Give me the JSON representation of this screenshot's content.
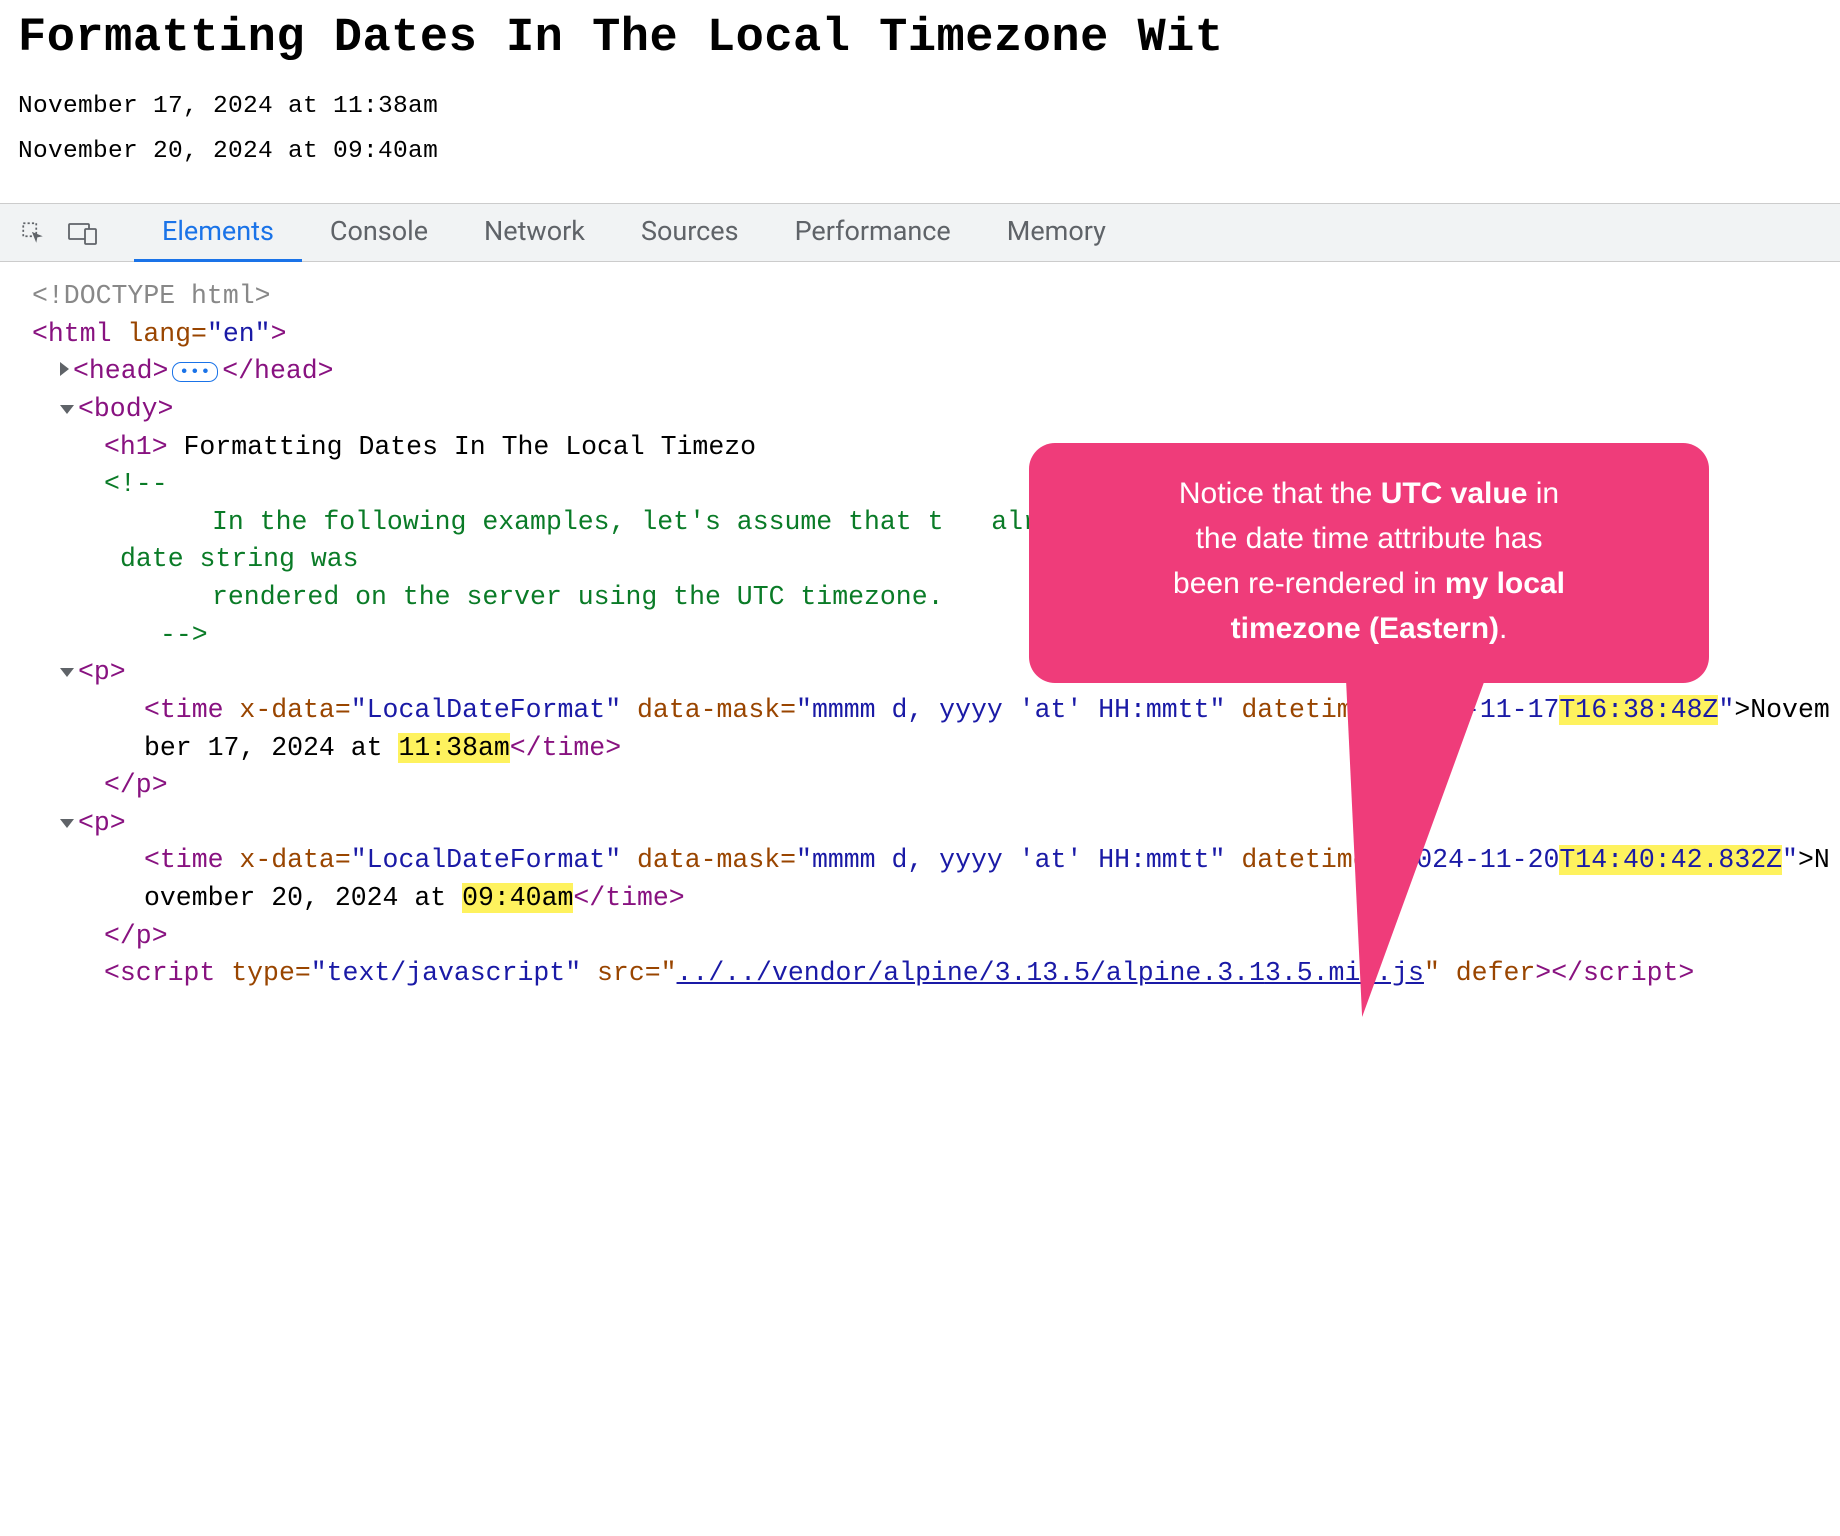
{
  "page": {
    "title": "Formatting Dates In The Local Timezone Wit",
    "date1": "November 17, 2024 at 11:38am",
    "date2": "November 20, 2024 at 09:40am"
  },
  "tabs": {
    "elements": "Elements",
    "console": "Console",
    "network": "Network",
    "sources": "Sources",
    "performance": "Performance",
    "memory": "Memory"
  },
  "dom": {
    "doctype": "<!DOCTYPE html>",
    "html_open": "<html",
    "html_lang_attr": " lang=",
    "html_lang_val": "\"en\"",
    "html_close": ">",
    "head_open": "<head>",
    "head_close": "</head>",
    "body_open": "<body>",
    "h1_open": "<h1>",
    "h1_text": " Formatting Dates In The Local Timezo",
    "comment_open": "<!--",
    "comment_line1": "In the following examples, let's assume that t   already-rendered ",
    "comment_line1b": "date string was",
    "comment_line2": "rendered on the server using the UTC timezone.",
    "comment_close": "-->",
    "p_open": "<p>",
    "p_close": "</p>",
    "time_open": "<time",
    "xdata_attr": " x-data=",
    "xdata_val": "\"LocalDateFormat\"",
    "mask_attr": " data-mask=",
    "mask_val": "\"mmmm d, yyyy 'at' HH:mmtt\"",
    "dt_attr": "datetime=",
    "dt1_pre": "\"2024-11-17",
    "dt1_hl": "T16:38:48Z",
    "dt1_post": "\"",
    "time1_text_pre": ">November 17, 2024 at ",
    "time1_text_hl": "11:38am",
    "time_close": "</time>",
    "dt2_pre": "\"2024-11-20",
    "dt2_hl": "T14:40:42.832Z",
    "dt2_post": "\"",
    "time2_text_pre": ">November 20, 2024 at ",
    "time2_text_hl": "09:40am",
    "script_open": "<script",
    "script_type_attr": " type=",
    "script_type_val": "\"text/javascript\"",
    "script_src_attr": " src=\"",
    "script_src_link1": "../../vendor/alpine/3.13.5/alpine.3.1",
    "script_src_link2": "3.5.min.js",
    "script_src_close": "\"",
    "script_defer": " defer",
    "script_tagclose": ">",
    "script_close": "</script>"
  },
  "callout": {
    "line1a": "Notice that the ",
    "line1b": "UTC value",
    "line1c": " in",
    "line2": "the date time attribute has",
    "line3a": "been re-rendered in ",
    "line3b": "my local",
    "line4a": "timezone (Eastern)",
    "line4b": "."
  }
}
